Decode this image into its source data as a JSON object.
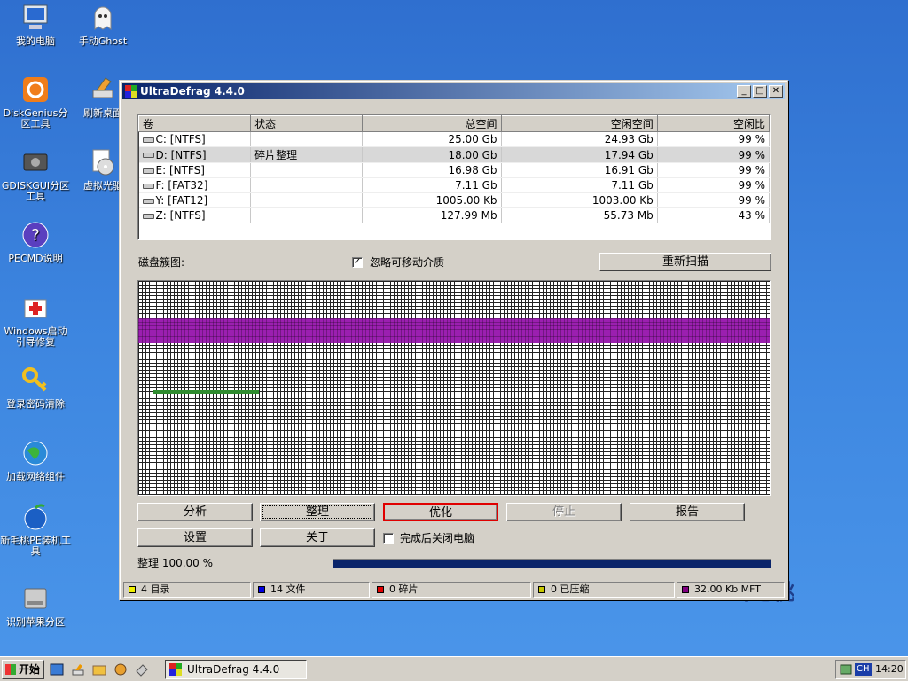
{
  "desktop": {
    "icons": [
      {
        "label": "我的电脑",
        "icon": "computer-icon"
      },
      {
        "label": "手动Ghost",
        "icon": "ghost-icon"
      },
      {
        "label": "DiskGenius分区工具",
        "icon": "diskgenius-icon"
      },
      {
        "label": "刷新桌面",
        "icon": "brush-icon"
      },
      {
        "label": "GDISKGUI分区工具",
        "icon": "gdisk-icon"
      },
      {
        "label": "虚拟光驱",
        "icon": "cd-icon"
      },
      {
        "label": "PECMD说明",
        "icon": "help-icon"
      },
      {
        "label": "Windows启动引导修复",
        "icon": "repair-icon"
      },
      {
        "label": "登录密码清除",
        "icon": "key-icon"
      },
      {
        "label": "加载网络组件",
        "icon": "network-icon"
      },
      {
        "label": "新毛桃PE装机工具",
        "icon": "peach-icon"
      },
      {
        "label": "识别苹果分区",
        "icon": "drive-icon"
      }
    ],
    "brand_text": "新毛桃"
  },
  "window": {
    "title": "UltraDefrag 4.4.0",
    "columns": [
      "卷",
      "状态",
      "总空间",
      "空闲空间",
      "空闲比"
    ],
    "rows": [
      {
        "volume": "C: [NTFS]",
        "status": "",
        "total": "25.00 Gb",
        "free": "24.93 Gb",
        "ratio": "99 %"
      },
      {
        "volume": "D: [NTFS]",
        "status": "碎片整理",
        "total": "18.00 Gb",
        "free": "17.94 Gb",
        "ratio": "99 %"
      },
      {
        "volume": "E: [NTFS]",
        "status": "",
        "total": "16.98 Gb",
        "free": "16.91 Gb",
        "ratio": "99 %"
      },
      {
        "volume": "F: [FAT32]",
        "status": "",
        "total": "7.11 Gb",
        "free": "7.11 Gb",
        "ratio": "99 %"
      },
      {
        "volume": "Y: [FAT12]",
        "status": "",
        "total": "1005.00 Kb",
        "free": "1003.00 Kb",
        "ratio": "99 %"
      },
      {
        "volume": "Z: [NTFS]",
        "status": "",
        "total": "127.99 Mb",
        "free": "55.73 Mb",
        "ratio": "43 %"
      }
    ],
    "selected_row": 1,
    "cluster_map_label": "磁盘簇图:",
    "skip_removable_label": "忽略可移动介质",
    "skip_removable_checked": true,
    "rescan_button": "重新扫描",
    "buttons": {
      "analyze": "分析",
      "defrag": "整理",
      "optimize": "优化",
      "stop": "停止",
      "report": "报告",
      "settings": "设置",
      "about": "关于"
    },
    "shutdown_label": "完成后关闭电脑",
    "shutdown_checked": false,
    "progress_text": "整理 100.00 %",
    "progress_percent": 100,
    "statusbar": [
      {
        "text": "4 目录",
        "color": "#f0f000"
      },
      {
        "text": "14 文件",
        "color": "#0000e0"
      },
      {
        "text": "0 碎片",
        "color": "#e00000"
      },
      {
        "text": "0 已压缩",
        "color": "#c8c800"
      },
      {
        "text": "32.00 Kb MFT",
        "color": "#800080"
      }
    ]
  },
  "taskbar": {
    "start_label": "开始",
    "task_label": "UltraDefrag 4.4.0",
    "tray_lang": "CH",
    "clock": "14:20"
  }
}
